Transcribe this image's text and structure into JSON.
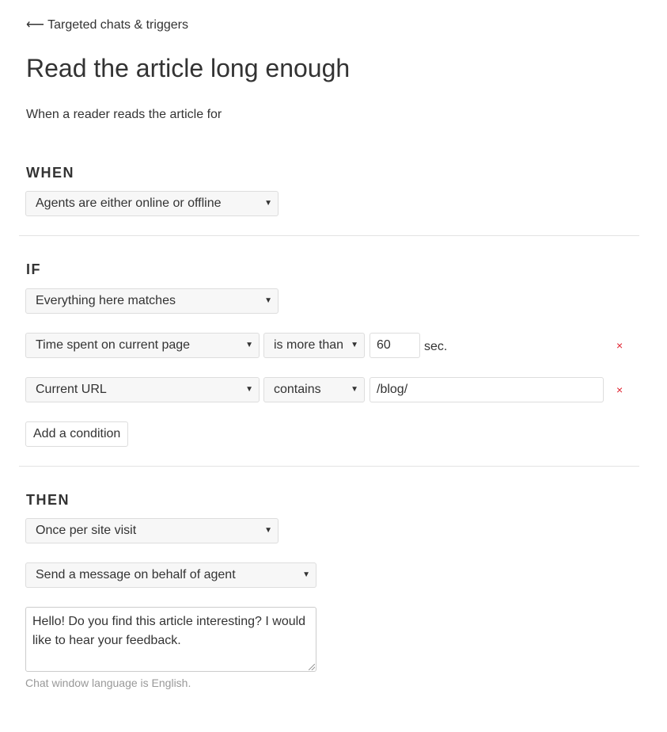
{
  "back_link": {
    "icon": "arrow-left-icon",
    "arrow": "⟵",
    "label": "Targeted chats & triggers"
  },
  "title": "Read the article long enough",
  "description": "When a reader reads the article for",
  "when": {
    "heading": "WHEN",
    "select": "Agents are either online or offline"
  },
  "if": {
    "heading": "IF",
    "match_select": "Everything here matches",
    "conditions": [
      {
        "field": "Time spent on current page",
        "operator": "is more than",
        "value": "60",
        "unit": "sec.",
        "remove": "×"
      },
      {
        "field": "Current URL",
        "operator": "contains",
        "value": "/blog/",
        "remove": "×"
      }
    ],
    "add_button": "Add a condition"
  },
  "then": {
    "heading": "THEN",
    "frequency_select": "Once per site visit",
    "action_select": "Send a message on behalf of agent",
    "message": "Hello! Do you find this article interesting? I would like to hear your feedback.",
    "hint": "Chat window language is English."
  },
  "colors": {
    "remove": "#e0202e",
    "hint": "#999999"
  }
}
